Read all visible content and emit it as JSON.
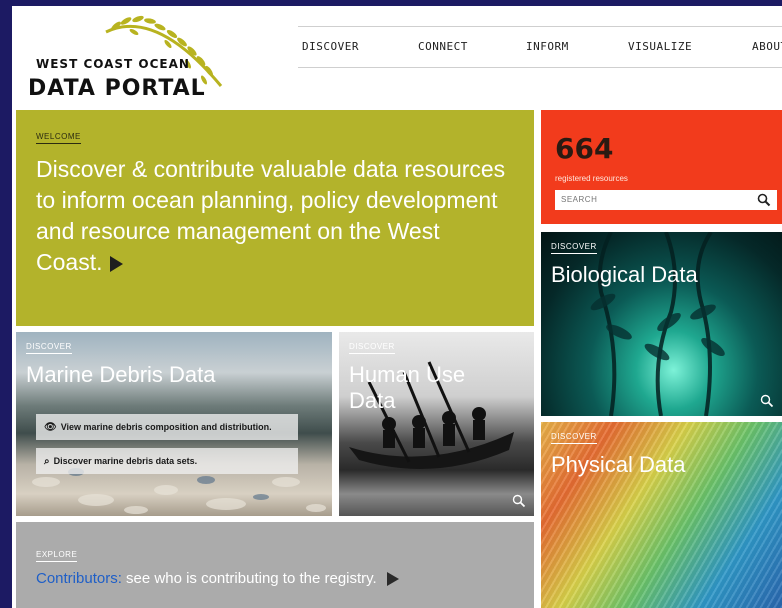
{
  "header": {
    "logo_line1": "WEST COAST OCEAN",
    "logo_line2": "DATA PORTAL",
    "nav": [
      "DISCOVER",
      "CONNECT",
      "INFORM",
      "VISUALIZE",
      "ABOUT"
    ]
  },
  "welcome": {
    "kicker": "WELCOME",
    "text": "Discover & contribute valuable data resources to inform ocean planning, policy development and resource management on the West Coast."
  },
  "registry": {
    "count": "664",
    "label": "registered resources",
    "search_placeholder": "SEARCH"
  },
  "tiles": {
    "marine_debris": {
      "kicker": "DISCOVER",
      "title": "Marine Debris Data",
      "btn1": "View marine debris composition and distribution.",
      "btn2": "Discover marine debris data sets."
    },
    "human_use": {
      "kicker": "DISCOVER",
      "title": "Human Use Data"
    },
    "biological": {
      "kicker": "DISCOVER",
      "title": "Biological Data"
    },
    "physical": {
      "kicker": "DISCOVER",
      "title": "Physical Data"
    }
  },
  "explore": {
    "kicker": "EXPLORE",
    "link": "Contributors:",
    "text": " see who is contributing to the registry."
  },
  "colors": {
    "background": "#1c1a63",
    "welcome": "#b3b32b",
    "registry": "#f23b1c",
    "explore": "#ababab",
    "link": "#1f5fc7"
  }
}
